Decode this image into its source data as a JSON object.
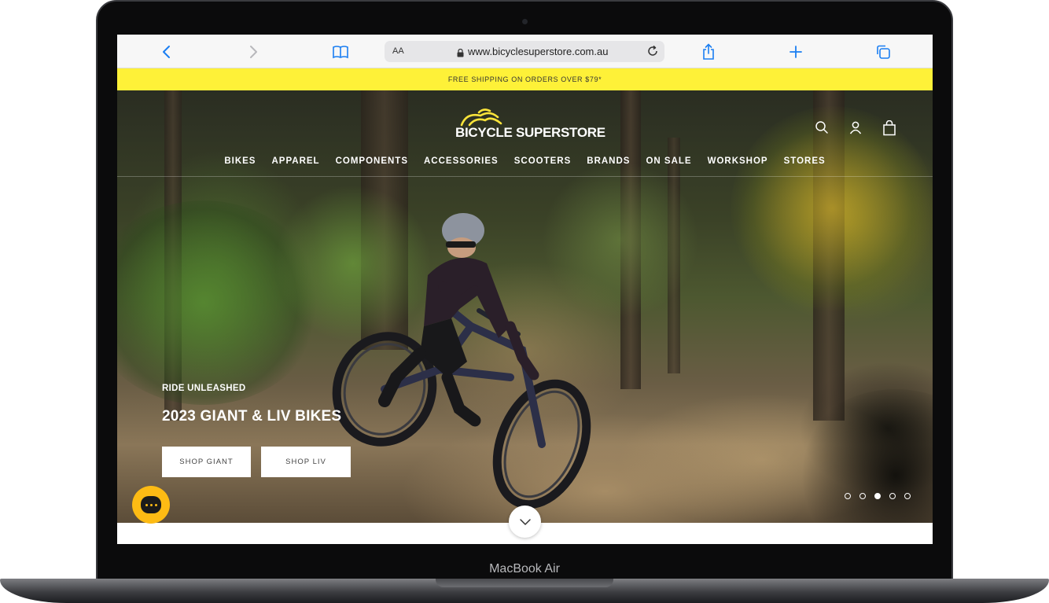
{
  "device": {
    "model_label": "MacBook Air"
  },
  "browser": {
    "text_size_label": "AA",
    "url": "www.bicyclesuperstore.com.au",
    "icons": [
      "back-icon",
      "forward-icon",
      "bookmarks-icon",
      "lock-icon",
      "reload-icon",
      "share-icon",
      "new-tab-icon",
      "tabs-icon"
    ]
  },
  "promo": {
    "text": "FREE SHIPPING ON ORDERS OVER $79*",
    "color": "#fef138"
  },
  "site": {
    "logo_text": "BICYCLE SUPERSTORE",
    "header_icons": [
      "search-icon",
      "account-icon",
      "cart-icon"
    ],
    "nav": [
      "BIKES",
      "APPAREL",
      "COMPONENTS",
      "ACCESSORIES",
      "SCOOTERS",
      "BRANDS",
      "ON SALE",
      "WORKSHOP",
      "STORES"
    ]
  },
  "hero": {
    "kicker": "RIDE UNLEASHED",
    "headline": "2023 GIANT & LIV BIKES",
    "cta_giant": "SHOP GIANT",
    "cta_liv": "SHOP LIV",
    "slide_count": 5,
    "active_slide": 3
  },
  "widgets": {
    "chat_icon": "chat-icon",
    "scroll_icon": "chevron-down-icon",
    "accent_color": "#fdbb14"
  }
}
